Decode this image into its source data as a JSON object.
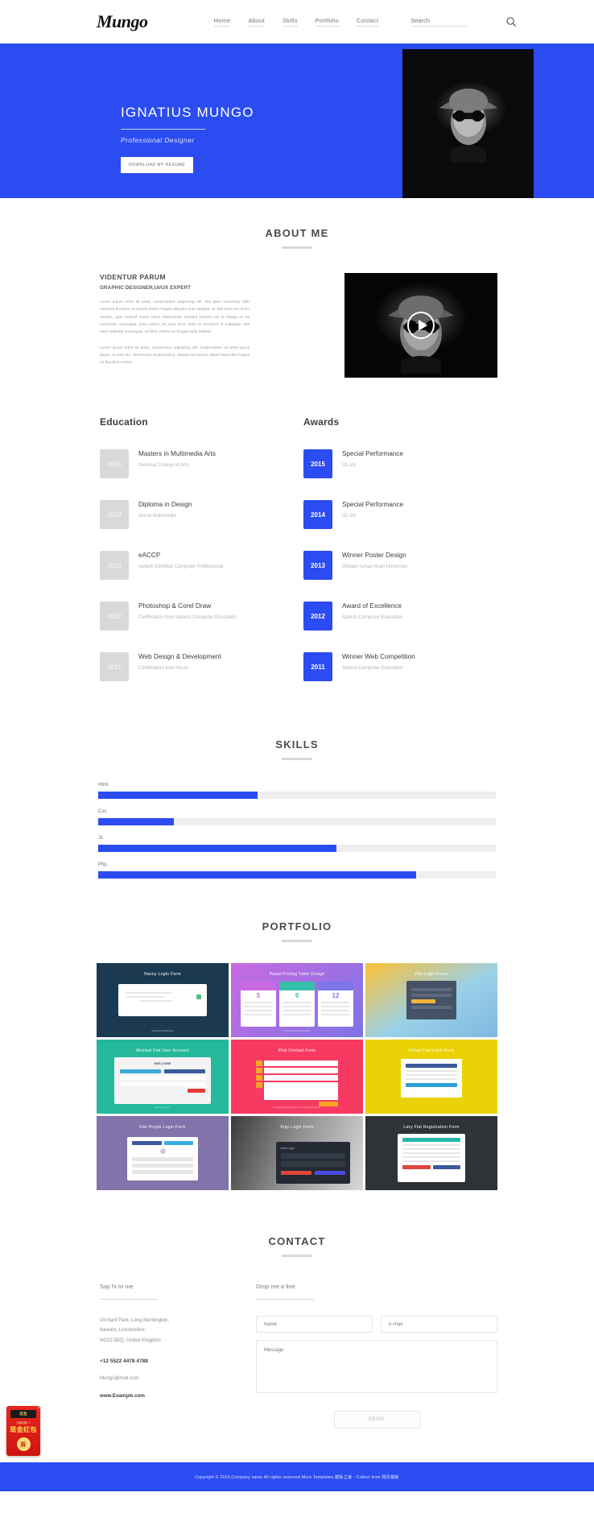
{
  "header": {
    "logo": "Mungo",
    "nav": [
      {
        "label": "Home"
      },
      {
        "label": "About"
      },
      {
        "label": "Skills"
      },
      {
        "label": "Portfolio"
      },
      {
        "label": "Contact"
      }
    ],
    "search_placeholder": "Search",
    "search_value": ""
  },
  "hero": {
    "name": "IGNATIUS MUNGO",
    "role": "Professional Designer",
    "button": "DOWNLOAD MY RESUME"
  },
  "about": {
    "title": "ABOUT ME",
    "heading": "VIDENTUR PARUM",
    "subheading": "GRAPHIC DESIGNER,UI/UX EXPERT",
    "paragraph1": "Lorem ipsum dolor sit amet, consectetuer adipiscing elit, sed diam nonummy nibh euismod tincidunt ut laoreet dolore magna aliquam erat volutpat. Ut wisi enim ad minim veniam, quis nostrud exerci tation ullamcorper suscipit lobortis nisl ut aliquip ex ea commodo consequat. Duis autem vel eum iriure dolor in hendrerit in vulputate velit esse molestie consequat, vel illum dolore eu feugiat nulla facilisis.",
    "paragraph2": "Lorem ipsum dolor sit amet, consectetur adipiscing elit. Suspendisse sit amet purus ipsum. In ante leo, elementum at placerat in, aliquet non lectus. Etiam imperdiet magna eu faucibus cursus."
  },
  "education": {
    "heading": "Education",
    "items": [
      {
        "year": "2015",
        "title": "Masters in Multimedia Arts",
        "sub": "National College of Arts"
      },
      {
        "year": "2014",
        "title": "Diploma in Design",
        "sub": "Arena Multimedia"
      },
      {
        "year": "2013",
        "title": "eACCP",
        "sub": "Aptech Certified Computer Professional"
      },
      {
        "year": "2012",
        "title": "Photoshop & Corel Draw",
        "sub": "Certification from Aptech Computer Education"
      },
      {
        "year": "2011",
        "title": "Web Design & Development",
        "sub": "Certification from Nicon"
      }
    ]
  },
  "awards": {
    "heading": "Awards",
    "items": [
      {
        "year": "2015",
        "title": "Special Performance",
        "sub": "I2c Inc"
      },
      {
        "year": "2014",
        "title": "Special Performance",
        "sub": "I2c Inc"
      },
      {
        "year": "2013",
        "title": "Winner Poster Design",
        "sub": "Ghulam Ishaq Khan University"
      },
      {
        "year": "2012",
        "title": "Award of Excellence",
        "sub": "Aptech Computer Education"
      },
      {
        "year": "2011",
        "title": "Winner Web Competition",
        "sub": "Aptech Computer Education"
      }
    ]
  },
  "skills": {
    "title": "SKILLS",
    "items": [
      {
        "label": "Html",
        "percent": 40
      },
      {
        "label": "Css",
        "percent": 19
      },
      {
        "label": "Js",
        "percent": 60
      },
      {
        "label": "Php",
        "percent": 80
      }
    ]
  },
  "portfolio": {
    "title": "PORTFOLIO",
    "items": [
      {
        "caption": "Navey Login Form",
        "bg": "#1b3a52",
        "footer": "Designed by Webcoder"
      },
      {
        "caption": "Pastel Pricing Table Design",
        "bg": "#a862d8",
        "footer": "Pastel Pricing Table Design"
      },
      {
        "caption": "Flat Login Panel",
        "bg": "#f0c04a",
        "footer": ""
      },
      {
        "caption": "Minimal Flat User Account",
        "bg": "#24b99a",
        "footer": "Flat Design Form"
      },
      {
        "caption": "Pink Contact Form",
        "bg": "#f73a62",
        "footer": "Copyright All Rights Reserved. Designed Webcoder"
      },
      {
        "caption": "Yellow Flat Login Form",
        "bg": "#ebd206",
        "footer": ""
      },
      {
        "caption": "Flat Purple Login Form",
        "bg": "#8273aa",
        "footer": ""
      },
      {
        "caption": "Kipy Login Form",
        "bg": "#6d6d6d",
        "footer": ""
      },
      {
        "caption": "Lavy Flat Registration Form",
        "bg": "#2f3237",
        "footer": ""
      }
    ]
  },
  "contact": {
    "title": "CONTACT",
    "left_heading": "Say hi to me",
    "right_heading": "Drop me a line",
    "address_line1": "Orchard Park, Long Bennington,",
    "address_line2": "Newark, Lincolnshire",
    "address_line3": "NG23 5DQ, United Kingdom",
    "phone": "+12 5522 4478 4788",
    "email": "Mungo@mail.com",
    "website": "www.Example.com",
    "name_placeholder": "Name",
    "email_placeholder": "E-mail",
    "message_placeholder": "Message",
    "name_value": "",
    "email_value": "",
    "message_value": "",
    "send_label": "SEND"
  },
  "footer": {
    "copyright": "Copyright © 2015.Company name All rights reserved.More Templates 模板之家 - Collect from 网页模板"
  },
  "ad": {
    "top_text": "红包",
    "sub_text": "天翻地覆1个",
    "main_text": "现金红包",
    "circle_text": "拆",
    "close": "×"
  },
  "colors": {
    "accent": "#2b4cf0",
    "muted": "#d9d9d9",
    "track": "#efefef"
  }
}
